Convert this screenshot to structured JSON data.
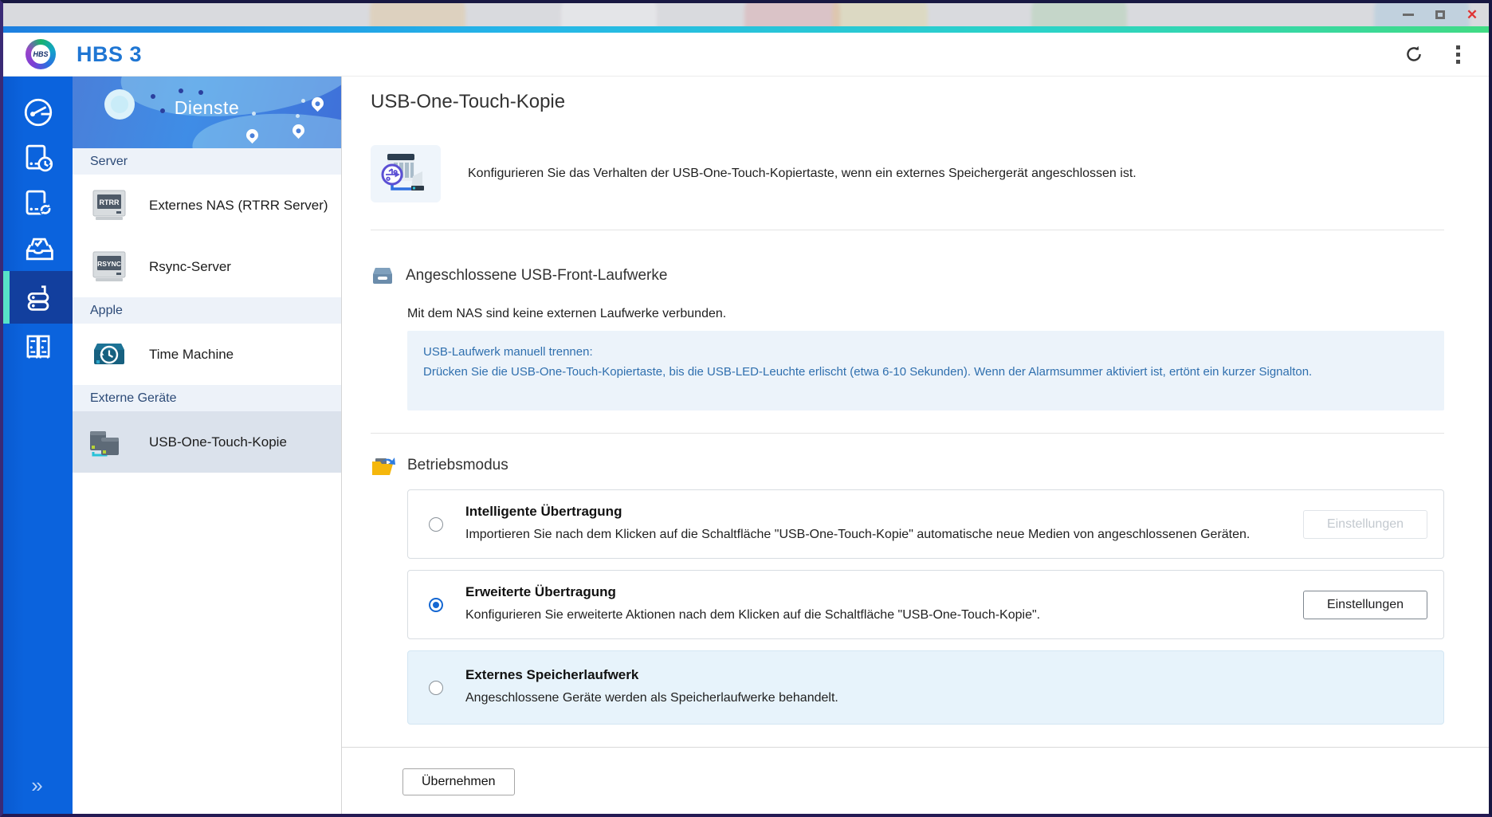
{
  "window_controls": {
    "minimize": "minimize",
    "maximize": "maximize",
    "close": "✕"
  },
  "header": {
    "logo_text": "HBS",
    "app_title": "HBS 3",
    "refresh_icon": "refresh-icon",
    "menu_icon": "kebab-menu-icon"
  },
  "rail": {
    "items": [
      {
        "name": "overview",
        "active": false
      },
      {
        "name": "backup",
        "active": false
      },
      {
        "name": "sync",
        "active": false
      },
      {
        "name": "restore",
        "active": false
      },
      {
        "name": "services",
        "active": true
      },
      {
        "name": "reports",
        "active": false
      }
    ],
    "collapse_label": "»"
  },
  "sidebar": {
    "title": "Dienste",
    "sections": [
      {
        "label": "Server",
        "items": [
          {
            "label": "Externes NAS (RTRR Server)",
            "badge": "RTRR"
          },
          {
            "label": "Rsync-Server",
            "badge": "RSYNC"
          }
        ]
      },
      {
        "label": "Apple",
        "items": [
          {
            "label": "Time Machine"
          }
        ]
      },
      {
        "label": "Externe Geräte",
        "items": [
          {
            "label": "USB-One-Touch-Kopie",
            "selected": true
          }
        ]
      }
    ]
  },
  "main": {
    "title": "USB-One-Touch-Kopie",
    "intro": "Konfigurieren Sie das Verhalten der USB-One-Touch-Kopiertaste, wenn ein externes Speichergerät angeschlossen ist.",
    "usb_section": {
      "heading": "Angeschlossene USB-Front-Laufwerke",
      "status": "Mit dem NAS sind keine externen Laufwerke verbunden.",
      "info_title": "USB-Laufwerk manuell trennen:",
      "info_body": "Drücken Sie die USB-One-Touch-Kopiertaste, bis die USB-LED-Leuchte erlischt (etwa 6-10 Sekunden). Wenn der Alarmsummer aktiviert ist, ertönt ein kurzer Signalton."
    },
    "mode_section": {
      "heading": "Betriebsmodus",
      "options": [
        {
          "title": "Intelligente Übertragung",
          "description": "Importieren Sie nach dem Klicken auf die Schaltfläche \"USB-One-Touch-Kopie\" automatische neue Medien von angeschlossenen Geräten.",
          "selected": false,
          "button_label": "Einstellungen",
          "button_disabled": true
        },
        {
          "title": "Erweiterte Übertragung",
          "description": "Konfigurieren Sie erweiterte Aktionen nach dem Klicken auf die Schaltfläche \"USB-One-Touch-Kopie\".",
          "selected": true,
          "button_label": "Einstellungen",
          "button_disabled": false
        },
        {
          "title": "Externes Speicherlaufwerk",
          "description": "Angeschlossene Geräte werden als Speicherlaufwerke behandelt.",
          "selected": false
        }
      ]
    },
    "apply_label": "Übernehmen"
  },
  "colors": {
    "accent_blue": "#0b63dd",
    "active_rail": "#123f9e",
    "active_indicator": "#57e3c8",
    "title_blue": "#1f76d3",
    "info_text": "#2f6fae",
    "radio_checked": "#1467d2",
    "close_red": "#e03434",
    "gradient_bar": [
      "#1d7fe0",
      "#25b6e8",
      "#2bd3c8",
      "#41db84"
    ]
  }
}
